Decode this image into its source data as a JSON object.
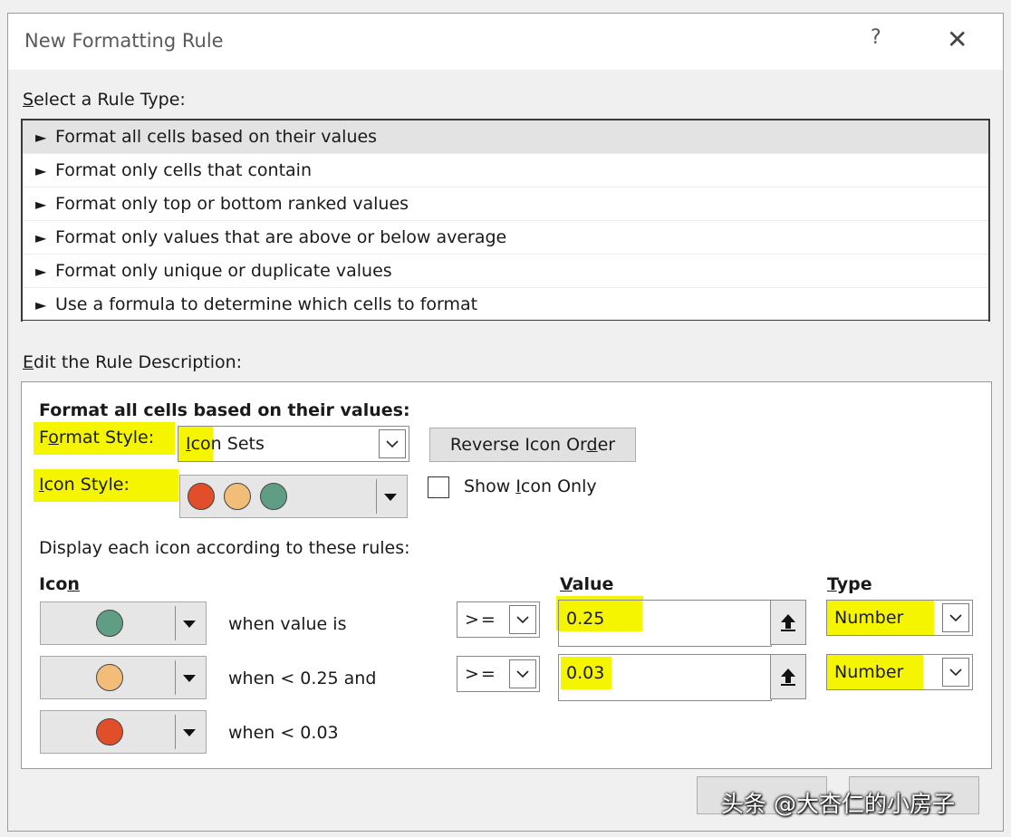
{
  "window": {
    "title": "New Formatting Rule",
    "help_glyph": "?",
    "close_glyph": "✕"
  },
  "rule_type": {
    "label_underline": "S",
    "label_rest": "elect a Rule Type:",
    "items": [
      "Format all cells based on their values",
      "Format only cells that contain",
      "Format only top or bottom ranked values",
      "Format only values that are above or below average",
      "Format only unique or duplicate values",
      "Use a formula to determine which cells to format"
    ],
    "selected_index": 0,
    "bullet": "►"
  },
  "description": {
    "label_underline": "E",
    "label_rest": "dit the Rule Description:",
    "heading": "Format all cells based on their values:",
    "format_style_label_a": "F",
    "format_style_label_u": "o",
    "format_style_label_b": "rmat Style:",
    "format_style_value_a": "I",
    "format_style_value_b": "con Sets",
    "reverse_icon_order_a": "Reverse Icon Or",
    "reverse_icon_order_u": "d",
    "reverse_icon_order_b": "er",
    "icon_style_label_u": "I",
    "icon_style_label_b": "con Style:",
    "show_icon_only_a": "Show ",
    "show_icon_only_u": "I",
    "show_icon_only_b": "con Only",
    "show_icon_only_checked": false,
    "rules_caption": "Display each icon according to these rules:",
    "col_icon_a": "Ico",
    "col_icon_u": "n",
    "col_value_a": "",
    "col_value_u": "V",
    "col_value_b": "alue",
    "col_type_u": "T",
    "col_type_b": "ype",
    "rows": [
      {
        "icon_color": "#5f9e85",
        "condition": "when value is",
        "operator": ">=",
        "value": "0.25",
        "type": "Number"
      },
      {
        "icon_color": "#f2bd78",
        "condition": "when < 0.25 and",
        "operator": ">=",
        "value": "0.03",
        "type": "Number"
      },
      {
        "icon_color": "#e24e2a",
        "condition": "when < 0.03"
      }
    ],
    "icon_style_colors": [
      "#e24e2a",
      "#f2bd78",
      "#5f9e85"
    ],
    "highlight_color": "#f6f500"
  },
  "watermark": "头条 @大杏仁的小房子"
}
